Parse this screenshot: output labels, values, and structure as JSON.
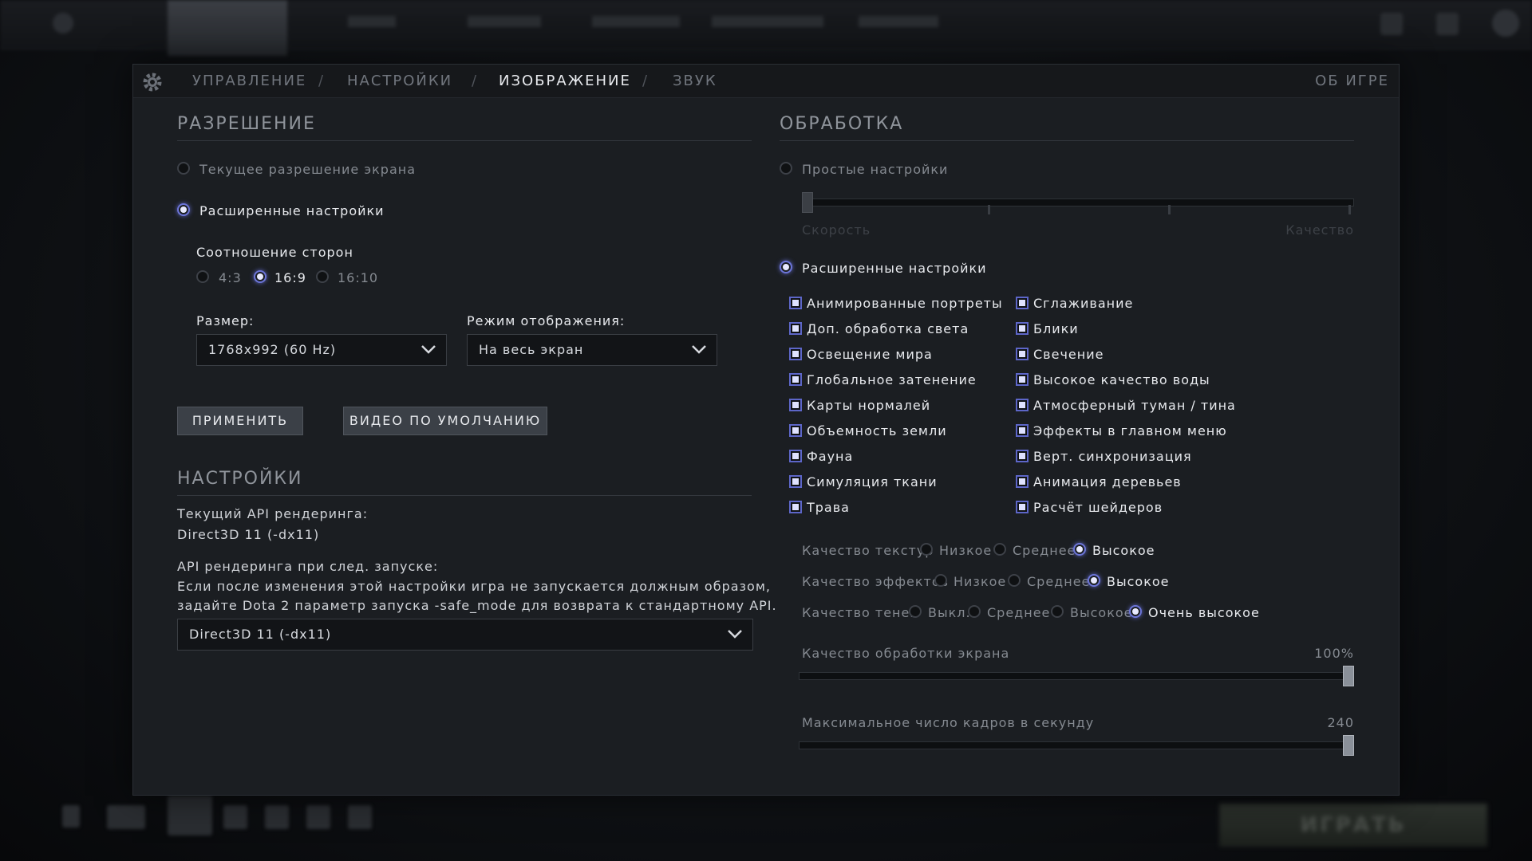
{
  "tabs": {
    "controls": "УПРАВЛЕНИЕ",
    "settings": "НАСТРОЙКИ",
    "video": "ИЗОБРАЖЕНИЕ",
    "sound": "ЗВУК",
    "about": "ОБ ИГРЕ",
    "separator": "/"
  },
  "resolution": {
    "title": "РАЗРЕШЕНИЕ",
    "current_label": "Текущее разрешение экрана",
    "advanced_label": "Расширенные настройки",
    "aspect_title": "Соотношение сторон",
    "aspects": [
      "4:3",
      "16:9",
      "16:10"
    ],
    "size_label": "Размер:",
    "size_value": "1768x992 (60 Hz)",
    "mode_label": "Режим отображения:",
    "mode_value": "На весь экран",
    "apply": "ПРИМЕНИТЬ",
    "defaults": "ВИДЕО ПО УМОЛЧАНИЮ"
  },
  "settings": {
    "title": "НАСТРОЙКИ",
    "api_current_label": "Текущий API рендеринга:",
    "api_current_value": "Direct3D 11 (-dx11)",
    "api_next_label": "API рендеринга при след. запуске:",
    "api_note_1": "Если после изменения этой настройки игра не запускается должным образом,",
    "api_note_2": "задайте Dota 2 параметр запуска -safe_mode для возврата к стандартному API.",
    "api_select": "Direct3D 11 (-dx11)"
  },
  "rendering": {
    "title": "ОБРАБОТКА",
    "simple_label": "Простые настройки",
    "speed_label": "Скорость",
    "quality_label": "Качество",
    "advanced_label": "Расширенные настройки",
    "left_checks": [
      "Анимированные портреты",
      "Доп. обработка света",
      "Освещение мира",
      "Глобальное затенение",
      "Карты нормалей",
      "Объемность земли",
      "Фауна",
      "Симуляция ткани",
      "Трава"
    ],
    "right_checks": [
      "Сглаживание",
      "Блики",
      "Свечение",
      "Высокое качество воды",
      "Атмосферный туман / тина",
      "Эффекты в главном меню",
      "Верт. синхронизация",
      "Анимация деревьев",
      "Расчёт шейдеров"
    ],
    "texture_label": "Качество текстур",
    "effects_label": "Качество эффектов",
    "shadow_label": "Качество теней",
    "low": "Низкое",
    "medium": "Среднее",
    "high": "Высокое",
    "off": "Выкл.",
    "medium2": "Среднее",
    "high2": "Высокое",
    "very_high": "Очень высокое",
    "screen_quality_label": "Качество обработки экрана",
    "screen_quality_value": "100%",
    "fps_label": "Максимальное число кадров в секунду",
    "fps_value": "240"
  },
  "bottom": {
    "play": "ИГРАТЬ"
  },
  "colors": {
    "accent": "#6c75d8",
    "panel": "#1b1e22"
  }
}
